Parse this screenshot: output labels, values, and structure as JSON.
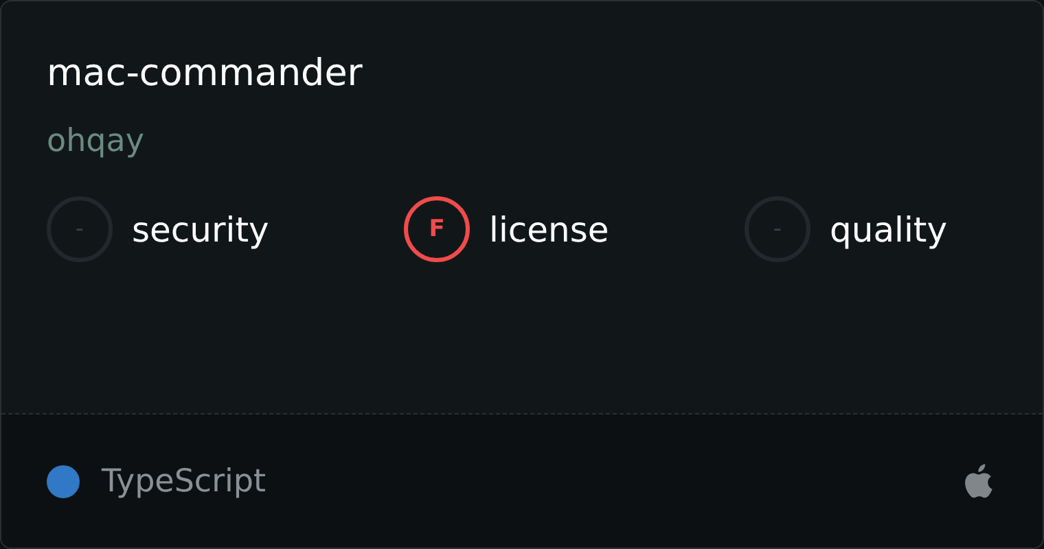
{
  "card": {
    "title": "mac-commander",
    "owner": "ohqay",
    "scores": [
      {
        "kind": "empty",
        "grade": "-",
        "label": "security"
      },
      {
        "kind": "graded",
        "grade": "F",
        "label": "license",
        "color": "#f24b4b"
      },
      {
        "kind": "empty",
        "grade": "-",
        "label": "quality"
      }
    ],
    "footer": {
      "language": {
        "name": "TypeScript",
        "color": "#3178c6"
      },
      "platform": {
        "kind": "apple"
      }
    }
  }
}
